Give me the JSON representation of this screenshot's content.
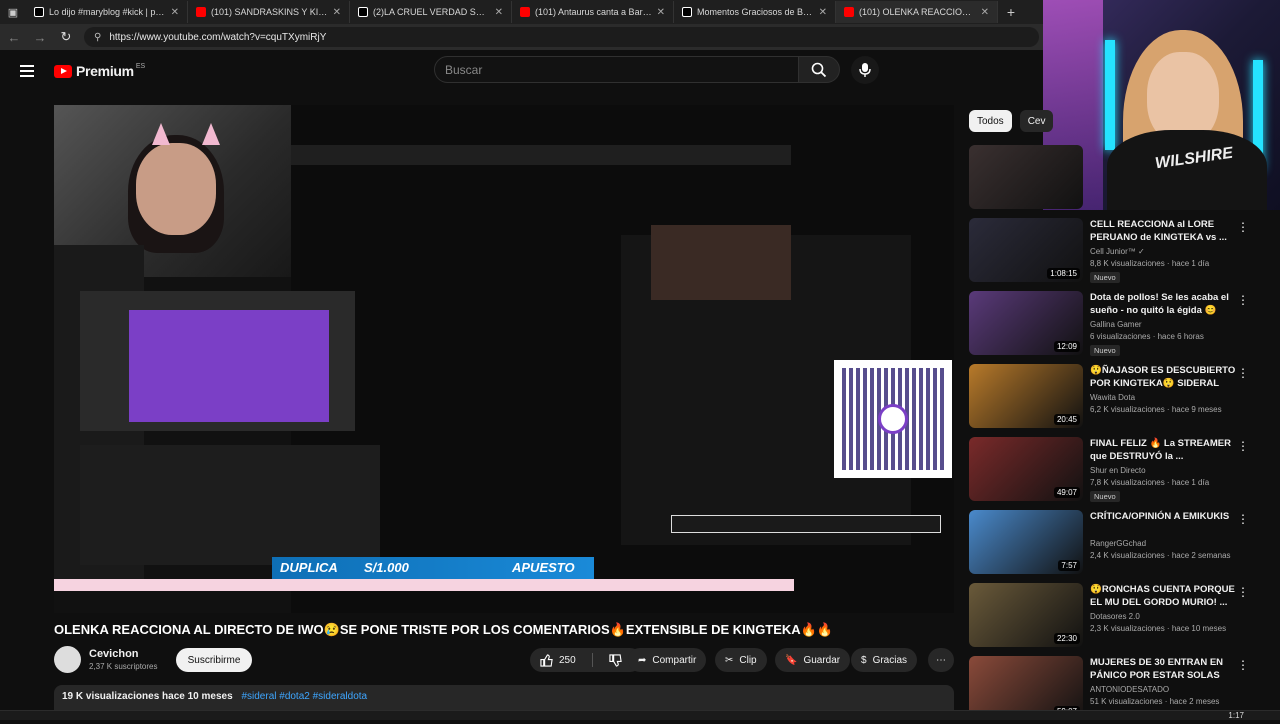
{
  "browser": {
    "tabs": [
      {
        "label": "Lo dijo #maryblog #kick | pero es",
        "type": "tt",
        "active": false
      },
      {
        "label": "(101) SANDRASKINS Y KINGTEKA",
        "type": "yt",
        "active": false
      },
      {
        "label": "(2)LA CRUEL VERDAD SOBRE CHI",
        "type": "tt",
        "active": false
      },
      {
        "label": "(101) Antaurus canta a Barbie FL",
        "type": "yt",
        "active": false
      },
      {
        "label": "Momentos Graciosos de Breaking",
        "type": "tt",
        "active": false
      },
      {
        "label": "(101) OLENKA REACCIONA A",
        "type": "yt",
        "active": true
      }
    ],
    "url": "https://www.youtube.com/watch?v=cquTXymiRjY"
  },
  "header": {
    "logo_text": "Premium",
    "country_code": "ES",
    "search_placeholder": "Buscar"
  },
  "video": {
    "inner_banner": {
      "text": "DUPLICA",
      "amount": "S/1.000",
      "tag": "APUESTO"
    },
    "title": "OLENKA REACCIONA AL DIRECTO DE IWO😢SE PONE TRISTE POR LOS COMENTARIOS🔥EXTENSIBLE DE KINGTEKA🔥🔥",
    "channel": "Cevichon",
    "subscribers": "2,37 K suscriptores",
    "subscribe_label": "Suscribirme",
    "likes": "250",
    "share_label": "Compartir",
    "clip_label": "Clip",
    "save_label": "Guardar",
    "thanks_label": "Gracias",
    "views_date": "19 K visualizaciones  hace 10 meses",
    "hashtags": "#sideral #dota2 #sideraldota"
  },
  "chips": [
    "Todos",
    "Cev"
  ],
  "recommendations": [
    {
      "title": "",
      "channel": "",
      "meta": "",
      "badge": "",
      "duration": "",
      "thumb": "#3a3030"
    },
    {
      "title": "CELL REACCIONA al LORE PERUANO de KINGTEKA vs ...",
      "channel": "Cell Junior™ ✓",
      "meta": "8,8 K visualizaciones · hace 1 día",
      "badge": "Nuevo",
      "duration": "1:08:15",
      "thumb": "#2b2b3a"
    },
    {
      "title": "Dota de pollos! Se les acaba el sueño - no quitó la égida 😊",
      "channel": "Gallina Gamer",
      "meta": "6 visualizaciones · hace 6 horas",
      "badge": "Nuevo",
      "duration": "12:09",
      "thumb": "#5a3a7a"
    },
    {
      "title": "😲ÑAJASOR ES DESCUBIERTO POR KINGTEKA😲 SIDERAL B...",
      "channel": "Wawita Dota",
      "meta": "6,2 K visualizaciones · hace 9 meses",
      "badge": "",
      "duration": "20:45",
      "thumb": "#b87a2a"
    },
    {
      "title": "FINAL FELIZ 🔥 La STREAMER que DESTRUYÓ la ...",
      "channel": "Shur en Directo",
      "meta": "7,8 K visualizaciones · hace 1 día",
      "badge": "Nuevo",
      "duration": "49:07",
      "thumb": "#7a2a2a"
    },
    {
      "title": "CRÍTICA/OPINIÓN  A EMIKUKIS",
      "channel": "RangerGGchad",
      "meta": "2,4 K visualizaciones · hace 2 semanas",
      "badge": "",
      "duration": "7:57",
      "thumb": "#4a8acc"
    },
    {
      "title": "😲RONCHAS CUENTA PORQUE EL MU DEL GORDO MURIO! ...",
      "channel": "Dotasores 2.0",
      "meta": "2,3 K visualizaciones · hace 10 meses",
      "badge": "",
      "duration": "22:30",
      "thumb": "#6a5a3a"
    },
    {
      "title": "MUJERES DE 30 ENTRAN EN PÁNICO POR ESTAR SOLAS",
      "channel": "ANTONIODESATADO",
      "meta": "51 K visualizaciones · hace 2 meses",
      "badge": "",
      "duration": "59:07",
      "thumb": "#8a4a3a"
    }
  ],
  "webcam": {
    "shirt_text": "WILSHIRE"
  },
  "taskbar": {
    "time": "1:17"
  },
  "colors": {
    "accent": "#ff0000",
    "background": "#0f0f0f",
    "link": "#3ea6ff"
  }
}
